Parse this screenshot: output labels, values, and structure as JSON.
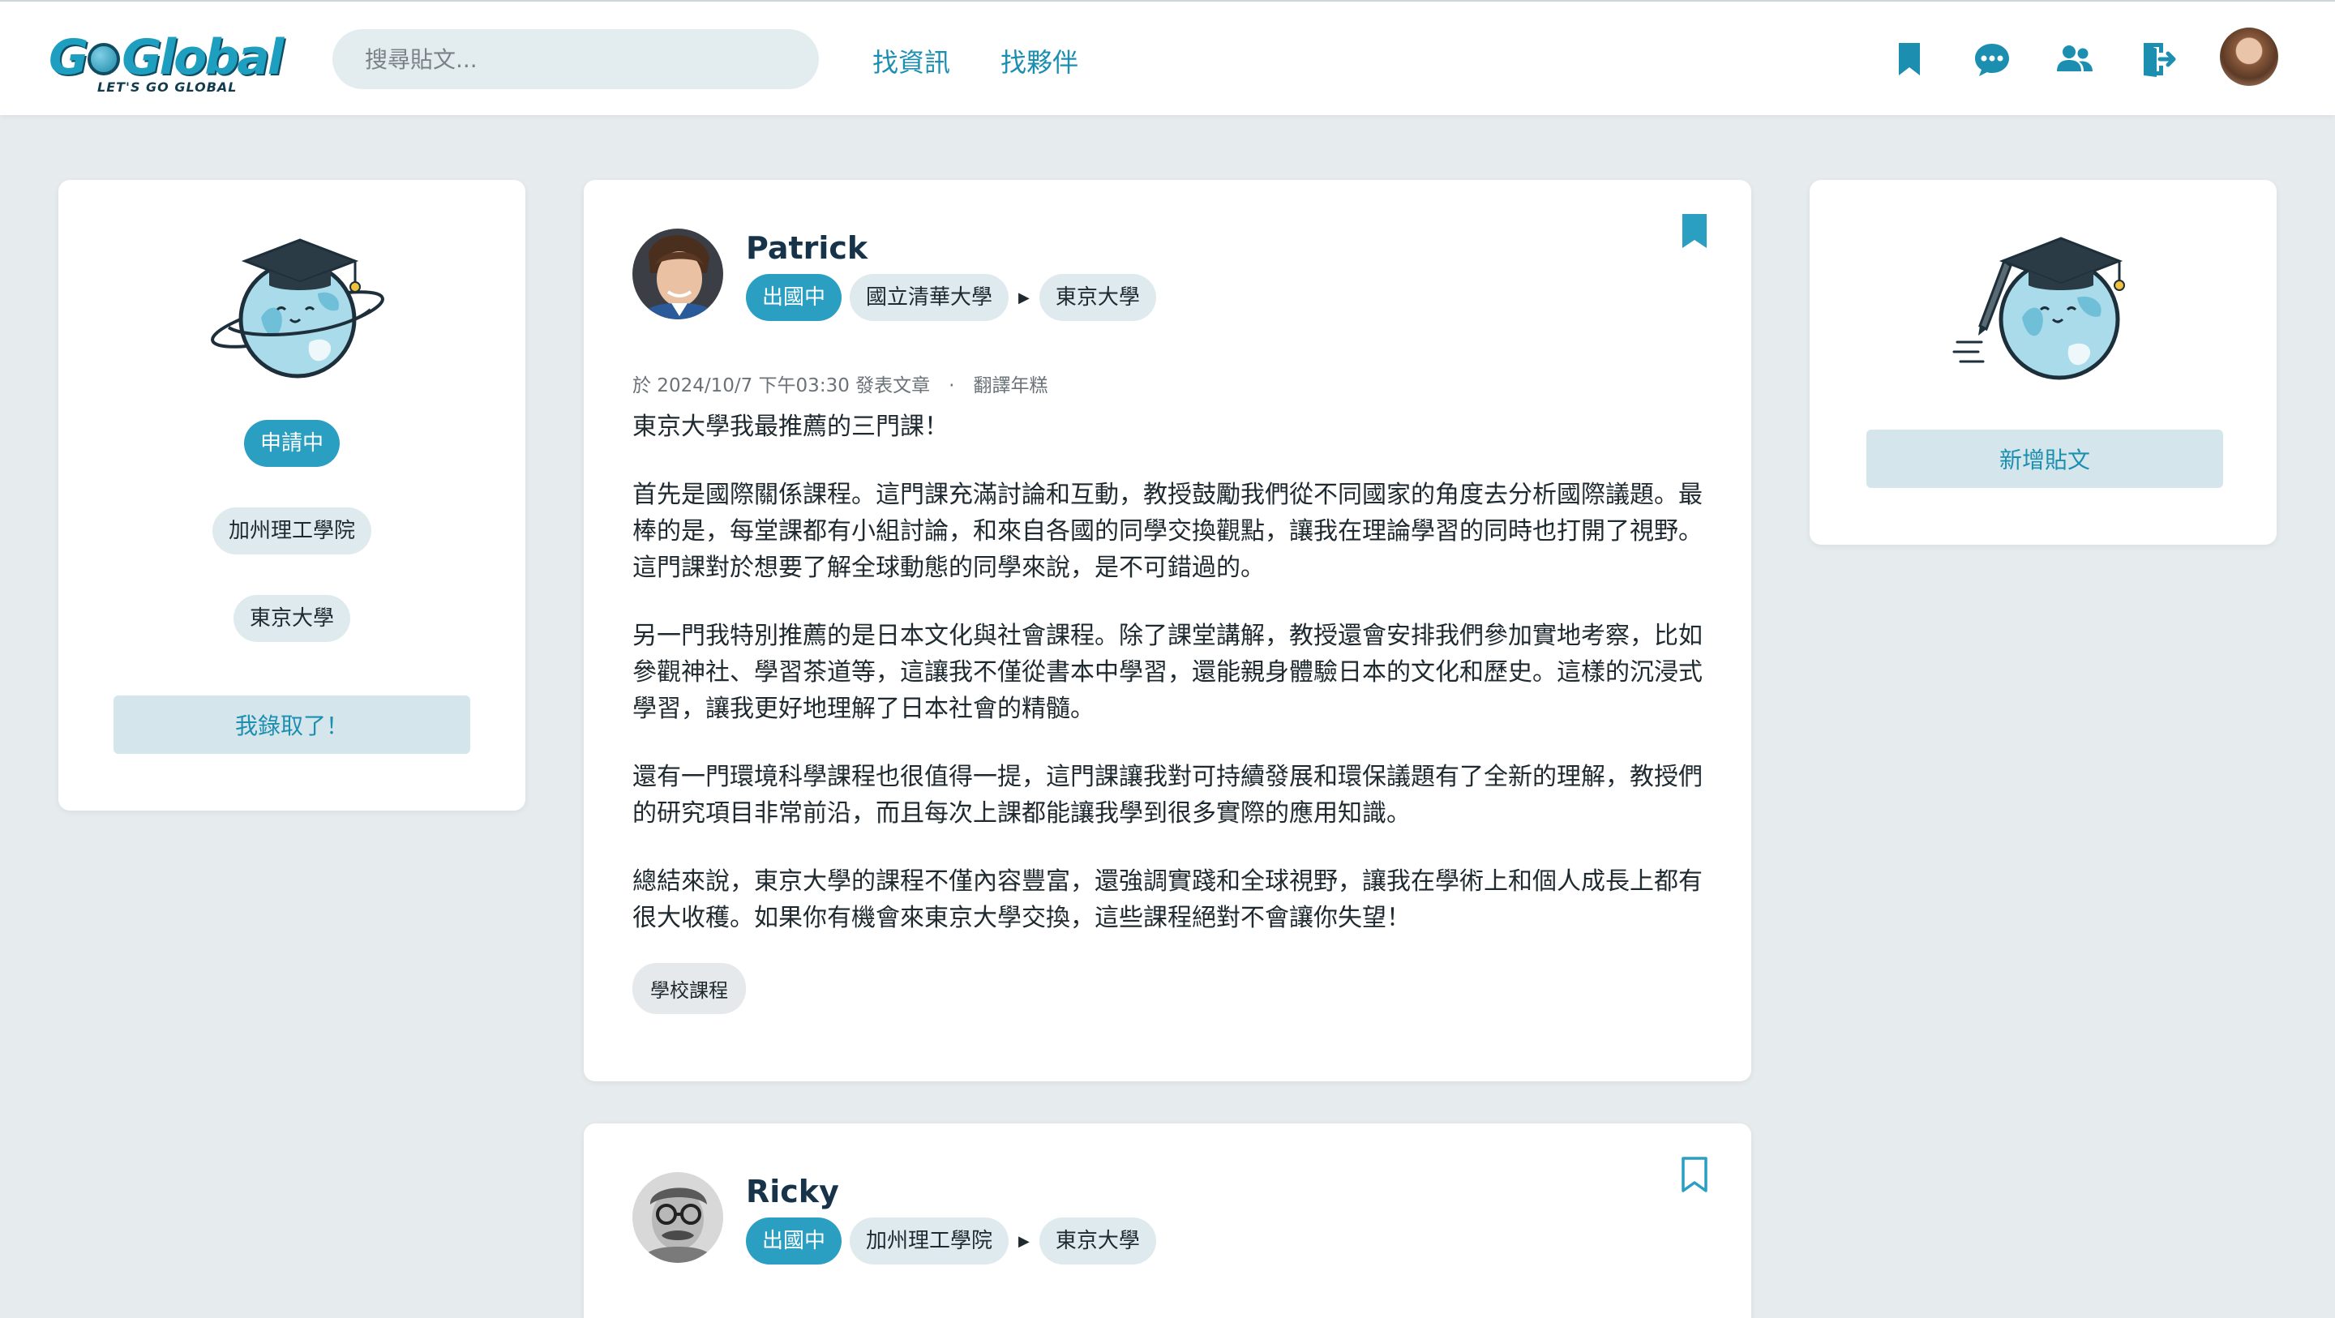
{
  "header": {
    "logo_text": "GoGlobal",
    "logo_tagline": "LET'S GO GLOBAL",
    "search_placeholder": "搜尋貼文...",
    "nav": [
      "找資訊",
      "找夥伴"
    ],
    "icons": [
      "bookmark-icon",
      "chat-icon",
      "friends-icon",
      "logout-icon"
    ],
    "accent_color": "#1c8fb0"
  },
  "profile_card": {
    "status": "申請中",
    "schools": [
      "加州理工學院",
      "東京大學"
    ],
    "admit_button": "我錄取了！"
  },
  "new_post_card": {
    "button": "新增貼文"
  },
  "posts": [
    {
      "author": "Patrick",
      "status": "出國中",
      "from_school": "國立清華大學",
      "to_school": "東京大學",
      "bookmarked": true,
      "meta": "於 2024/10/7 下午03:30 發表文章　·　翻譯年糕",
      "paragraphs": [
        "東京大學我最推薦的三門課！",
        "首先是國際關係課程。這門課充滿討論和互動，教授鼓勵我們從不同國家的角度去分析國際議題。最棒的是，每堂課都有小組討論，和來自各國的同學交換觀點，讓我在理論學習的同時也打開了視野。這門課對於想要了解全球動態的同學來說，是不可錯過的。",
        "另一門我特別推薦的是日本文化與社會課程。除了課堂講解，教授還會安排我們參加實地考察，比如參觀神社、學習茶道等，這讓我不僅從書本中學習，還能親身體驗日本的文化和歷史。這樣的沉浸式學習，讓我更好地理解了日本社會的精髓。",
        "還有一門環境科學課程也很值得一提，這門課讓我對可持續發展和環保議題有了全新的理解，教授們的研究項目非常前沿，而且每次上課都能讓我學到很多實際的應用知識。",
        "總結來說，東京大學的課程不僅內容豐富，還強調實踐和全球視野，讓我在學術上和個人成長上都有很大收穫。如果你有機會來東京大學交換，這些課程絕對不會讓你失望！"
      ],
      "topic": "學校課程"
    },
    {
      "author": "Ricky",
      "status": "出國中",
      "from_school": "加州理工學院",
      "to_school": "東京大學",
      "bookmarked": false
    }
  ]
}
